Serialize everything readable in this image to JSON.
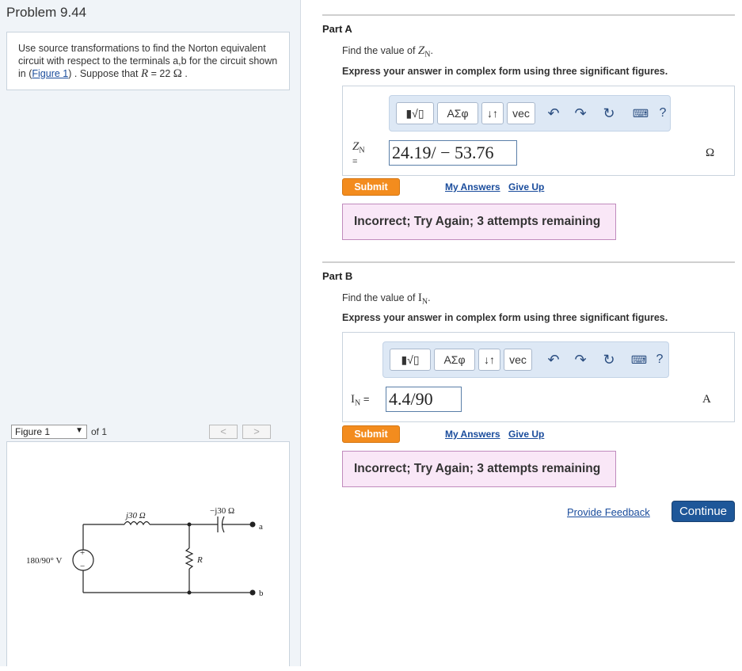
{
  "problem": {
    "title": "Problem 9.44",
    "text_before_link": "Use source transformations to find the Norton equivalent circuit with respect to the terminals a,b for the circuit shown in (",
    "figure_link": "Figure 1",
    "text_after_link": ") . Suppose that ",
    "var_r": "R",
    "r_value": " = 22 ",
    "r_unit": "Ω",
    "period": "."
  },
  "figure_nav": {
    "selected": "Figure 1",
    "of": "of 1",
    "prev": "<",
    "next": ">"
  },
  "circuit": {
    "source_label": "180/90° V",
    "plus": "+",
    "minus": "−",
    "inductor_label": "j30 Ω",
    "capacitor_label": "−j30 Ω",
    "resistor_label": "R",
    "terminal_a": "a",
    "terminal_b": "b"
  },
  "toolbar": {
    "template_label": "▮√▯",
    "greek_label": "ΑΣφ",
    "arrows_label": "↓↑",
    "vec_label": "vec",
    "undo_icon": "undo-icon",
    "redo_icon": "redo-icon",
    "reset_icon": "reset-icon",
    "keyboard_icon": "keyboard-icon",
    "help_label": "?"
  },
  "part_a": {
    "title": "Part A",
    "prompt": "Find the value of ",
    "prompt_var": "Z",
    "prompt_sub": "N",
    "prompt_end": ".",
    "instruction": "Express your answer in complex form using three significant figures.",
    "answer_label_var": "Z",
    "answer_label_sub": "N",
    "answer_label_eq": "=",
    "answer_value": "24.19/ − 53.76",
    "unit": "Ω",
    "submit": "Submit",
    "my_answers": "My Answers",
    "give_up": "Give Up",
    "feedback": "Incorrect; Try Again; 3 attempts remaining"
  },
  "part_b": {
    "title": "Part B",
    "prompt": "Find the value of ",
    "prompt_var": "I",
    "prompt_sub": "N",
    "prompt_end": ".",
    "instruction": "Express your answer in complex form using three significant figures.",
    "answer_label_var": "I",
    "answer_label_sub": "N",
    "answer_label_eq": "=",
    "answer_value": "4.4/90",
    "unit": "A",
    "submit": "Submit",
    "my_answers": "My Answers",
    "give_up": "Give Up",
    "feedback": "Incorrect; Try Again; 3 attempts remaining"
  },
  "footer": {
    "provide_feedback": "Provide Feedback",
    "continue": "Continue"
  },
  "colors": {
    "submit": "#f38c1e",
    "continue": "#1e5799",
    "feedback_bg": "#f9e7f7",
    "link": "#1a4c9c"
  }
}
